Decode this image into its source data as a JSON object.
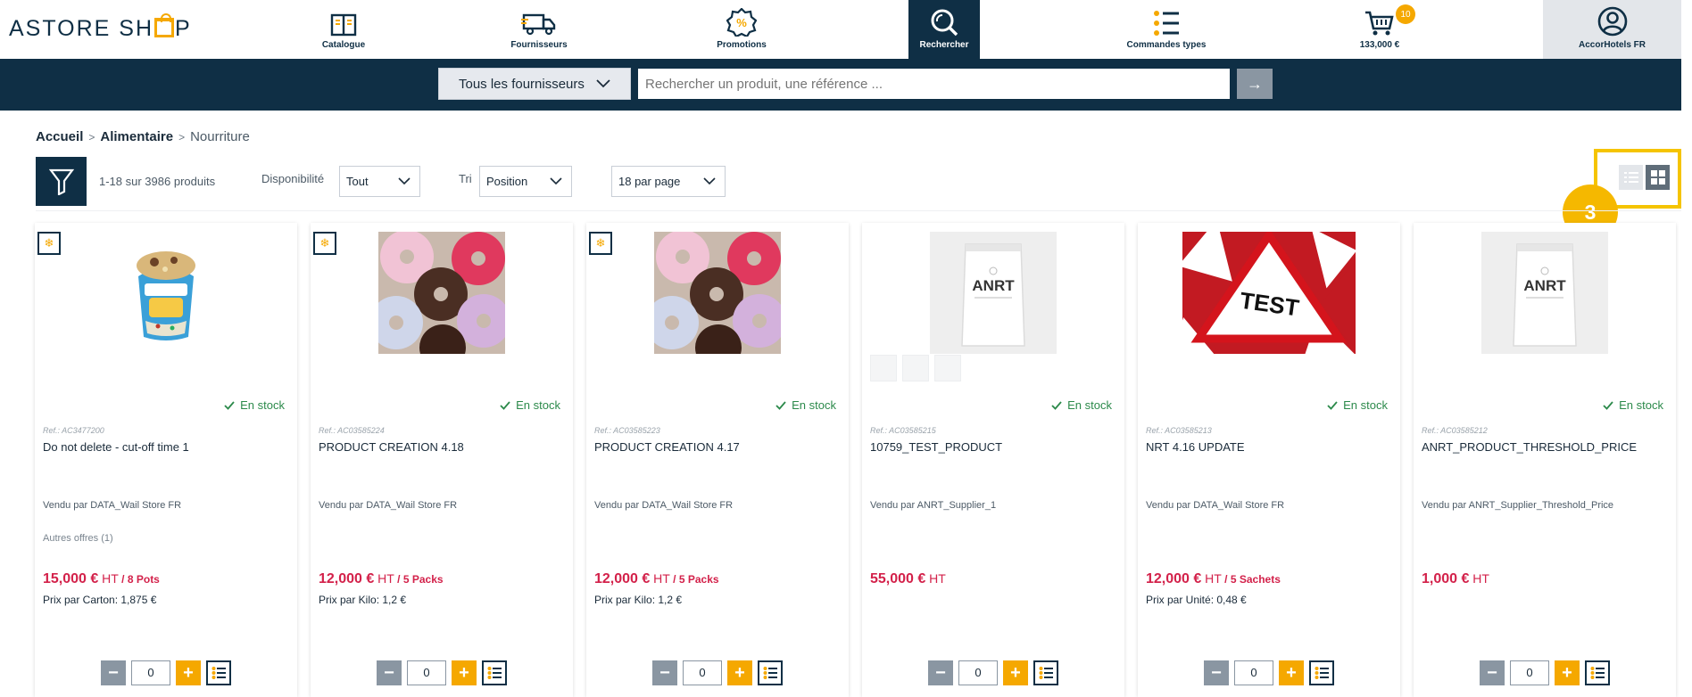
{
  "header": {
    "logo_text_a": "ASTORE SH",
    "logo_text_b": "P",
    "nav": {
      "catalogue": "Catalogue",
      "fournisseurs": "Fournisseurs",
      "promotions": "Promotions",
      "rechercher": "Rechercher",
      "commandes": "Commandes types",
      "cart_total": "133,000 €",
      "cart_count": "10",
      "account": "AccorHotels FR"
    }
  },
  "search": {
    "supplier_select": "Tous les fournisseurs",
    "placeholder": "Rechercher un produit, une référence ...",
    "go_arrow": "→"
  },
  "breadcrumb": {
    "home": "Accueil",
    "category": "Alimentaire",
    "current": "Nourriture",
    "separator": ">"
  },
  "toolbar": {
    "count": "1-18 sur 3986 produits",
    "availability_label": "Disponibilité",
    "availability_value": "Tout",
    "sort_label": "Tri",
    "sort_value": "Position",
    "per_page_value": "18 par page"
  },
  "step_badge": "3",
  "colors": {
    "navy": "#0f2f45",
    "accent": "#f5a800",
    "price_red": "#d3214a",
    "stock_green": "#2c8a4b",
    "highlight_yellow": "#f5c400"
  },
  "products": [
    {
      "ref": "Ref.: AC3477200",
      "name": "Do not delete - cut-off time 1",
      "stock": "En stock",
      "vendor": "Vendu par DATA_Wail Store FR",
      "offers": "Autres offres (1)",
      "price_amount": "15,000 €",
      "price_ht": " HT",
      "price_unit": " / 8 Pots",
      "unit_price": "Prix par Carton: 1,875 €",
      "qty": "0",
      "frozen": true,
      "image": "ice-cream-cup"
    },
    {
      "ref": "Ref.: AC03585224",
      "name": "PRODUCT CREATION 4.18",
      "stock": "En stock",
      "vendor": "Vendu par DATA_Wail Store FR",
      "offers": "",
      "price_amount": "12,000 €",
      "price_ht": " HT",
      "price_unit": " / 5 Packs",
      "unit_price": "Prix par Kilo: 1,2 €",
      "qty": "0",
      "frozen": true,
      "image": "donuts"
    },
    {
      "ref": "Ref.: AC03585223",
      "name": "PRODUCT CREATION 4.17",
      "stock": "En stock",
      "vendor": "Vendu par DATA_Wail Store FR",
      "offers": "",
      "price_amount": "12,000 €",
      "price_ht": " HT",
      "price_unit": " / 5 Packs",
      "unit_price": "Prix par Kilo: 1,2 €",
      "qty": "0",
      "frozen": true,
      "image": "donuts"
    },
    {
      "ref": "Ref.: AC03585215",
      "name": "10759_TEST_PRODUCT",
      "stock": "En stock",
      "vendor": "Vendu par ANRT_Supplier_1",
      "offers": "",
      "price_amount": "55,000 €",
      "price_ht": " HT",
      "price_unit": "",
      "unit_price": "",
      "qty": "0",
      "frozen": false,
      "image": "anrt-pouch",
      "image_text": "ANRT"
    },
    {
      "ref": "Ref.: AC03585213",
      "name": "NRT 4.16 UPDATE",
      "stock": "En stock",
      "vendor": "Vendu par DATA_Wail Store FR",
      "offers": "",
      "price_amount": "12,000 €",
      "price_ht": " HT",
      "price_unit": " / 5 Sachets",
      "unit_price": "Prix par Unité: 0,48 €",
      "qty": "0",
      "frozen": false,
      "image": "test-signs",
      "image_text": "TEST"
    },
    {
      "ref": "Ref.: AC03585212",
      "name": "ANRT_PRODUCT_THRESHOLD_PRICE",
      "stock": "En stock",
      "vendor": "Vendu par ANRT_Supplier_Threshold_Price",
      "offers": "",
      "price_amount": "1,000 €",
      "price_ht": " HT",
      "price_unit": "",
      "unit_price": "",
      "qty": "0",
      "frozen": false,
      "image": "anrt-pouch",
      "image_text": "ANRT"
    }
  ]
}
